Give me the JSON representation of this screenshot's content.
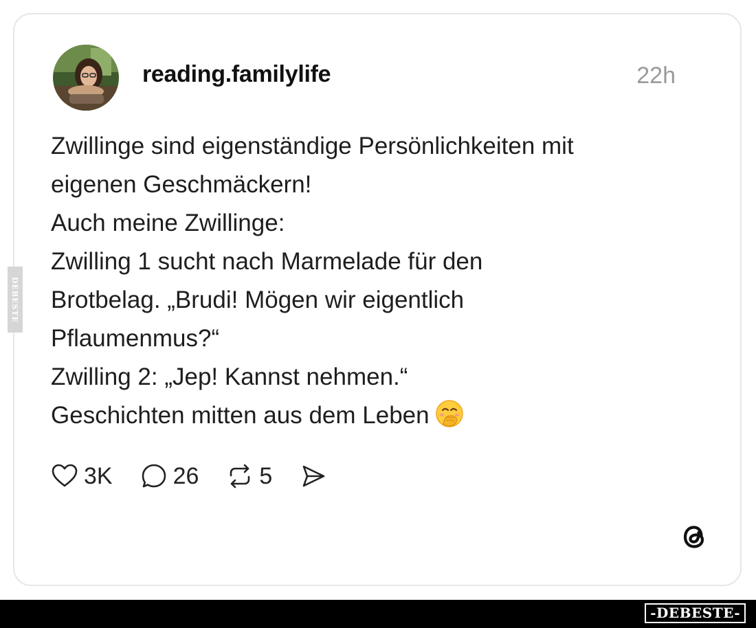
{
  "post": {
    "username": "reading.familylife",
    "time": "22h",
    "lines": [
      "Zwillinge sind eigenständige Persönlichkeiten mit",
      "eigenen Geschmäckern!",
      "Auch meine Zwillinge:",
      "Zwilling 1 sucht nach Marmelade für den",
      "Brotbelag. „Brudi! Mögen wir eigentlich",
      "Pflaumenmus?“",
      "Zwilling 2: „Jep! Kannst nehmen.“",
      "Geschichten mitten aus dem Leben"
    ],
    "trailing_emoji": "face-with-hand-over-mouth"
  },
  "actions": {
    "likes": "3K",
    "replies": "26",
    "reposts": "5"
  },
  "icons": {
    "like": "heart-icon",
    "reply": "comment-bubble-icon",
    "repost": "repost-icon",
    "share": "send-icon",
    "brand": "threads-logo-icon"
  },
  "watermark": {
    "side": "DEBESTE",
    "footer": "-DEBESTE-"
  },
  "colors": {
    "text": "#1e1e1e",
    "muted": "#9a9a9a",
    "card_border": "#e6e6e6",
    "footer": "#000000"
  }
}
